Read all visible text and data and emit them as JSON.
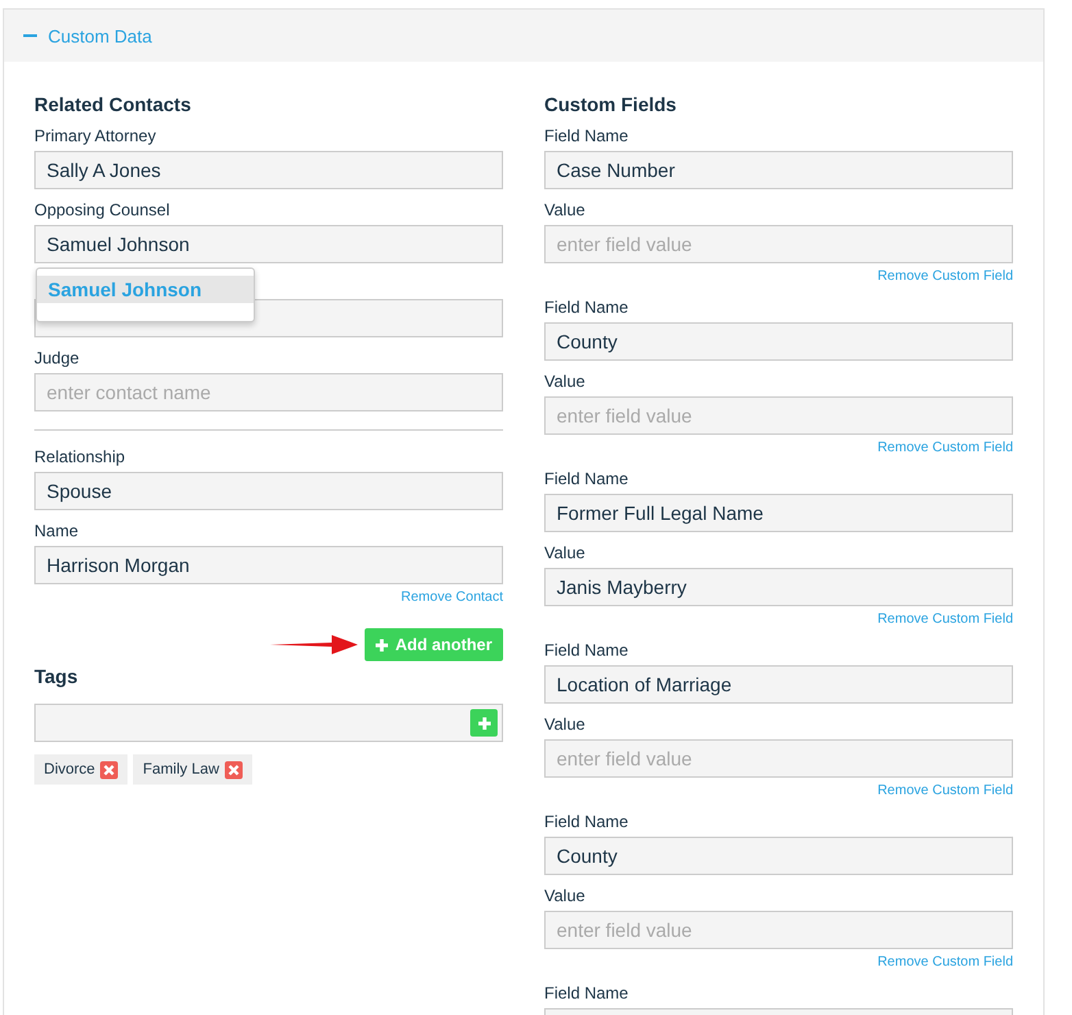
{
  "section": {
    "title": "Custom Data",
    "expanded": true
  },
  "related_contacts": {
    "heading": "Related Contacts",
    "contacts": [
      {
        "kind": "labeled",
        "label": "Primary Attorney",
        "value": "Sally A Jones"
      },
      {
        "kind": "labeled",
        "label": "Opposing Counsel",
        "value": "Samuel Johnson",
        "suggestions": [
          {
            "text": "Samuel Johnson",
            "selected": true
          }
        ]
      },
      {
        "kind": "covered"
      },
      {
        "kind": "labeled",
        "label": "Judge",
        "placeholder": "enter contact name"
      }
    ],
    "extra_contact": {
      "relationship_label": "Relationship",
      "relationship": "Spouse",
      "name_label": "Name",
      "name": "Harrison Morgan",
      "remove_link": "Remove Contact"
    },
    "add_button": "Add another"
  },
  "tags": {
    "heading": "Tags",
    "items": [
      {
        "label": "Divorce"
      },
      {
        "label": "Family Law"
      }
    ]
  },
  "custom_fields": {
    "heading": "Custom Fields",
    "fields": [
      {
        "name_label": "Field Name",
        "name": "Case Number",
        "value_label": "Value",
        "placeholder": "enter field value",
        "remove_link": "Remove Custom Field"
      },
      {
        "name_label": "Field Name",
        "name": "County",
        "value_label": "Value",
        "placeholder": "enter field value",
        "remove_link": "Remove Custom Field"
      },
      {
        "name_label": "Field Name",
        "name": "Former Full Legal Name",
        "value_label": "Value",
        "value": "Janis Mayberry",
        "remove_link": "Remove Custom Field"
      },
      {
        "name_label": "Field Name",
        "name": "Location of Marriage",
        "value_label": "Value",
        "placeholder": "enter field value",
        "remove_link": "Remove Custom Field"
      },
      {
        "name_label": "Field Name",
        "name": "County",
        "value_label": "Value",
        "placeholder": "enter field value",
        "remove_link": "Remove Custom Field"
      },
      {
        "name_label": "Field Name"
      }
    ]
  }
}
